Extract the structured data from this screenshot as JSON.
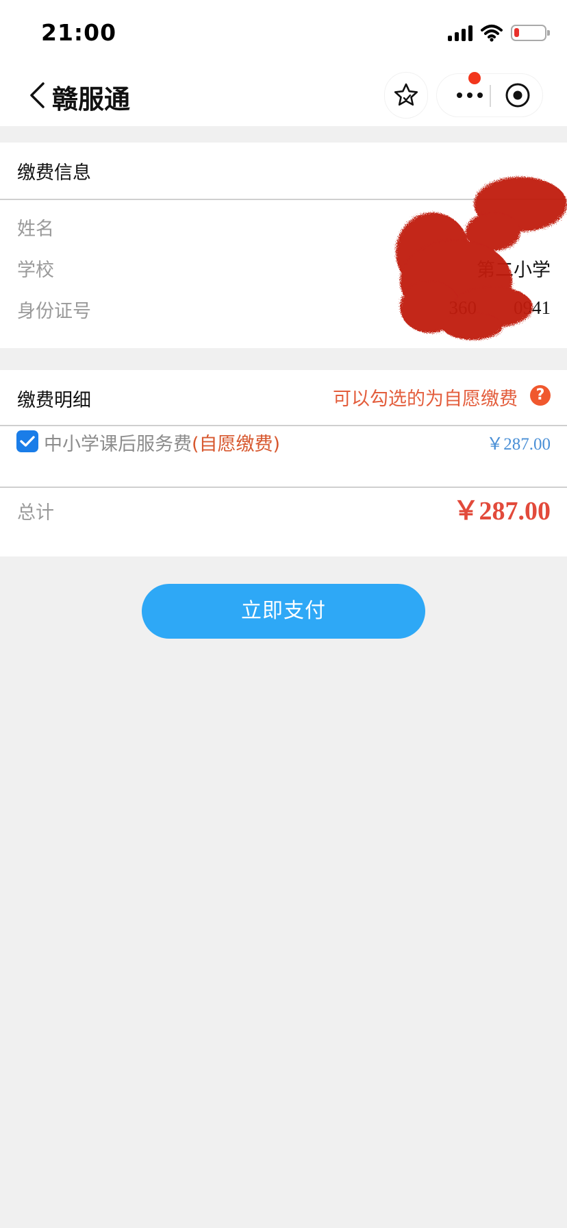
{
  "status_bar": {
    "time": "21:00",
    "icons": [
      "signal-icon",
      "wifi-icon",
      "battery-low-icon"
    ],
    "battery_level": 0.15,
    "battery_color": "#e8312c"
  },
  "nav": {
    "title": "赣服通",
    "back_icon": "chevron-left-icon",
    "favorite_icon": "star-icon",
    "more_icon": "more-dots-icon",
    "close_icon": "target-close-icon",
    "notification_dot_color": "#f2361c"
  },
  "payment_info": {
    "title": "缴费信息",
    "fields": [
      {
        "label": "姓名",
        "value": ""
      },
      {
        "label": "学校",
        "value": "第二小学"
      },
      {
        "label": "身份证号",
        "value": "360        0941"
      }
    ]
  },
  "payment_detail": {
    "title": "缴费明细",
    "hint": "可以勾选的为自愿缴费",
    "help_icon": "?",
    "items": [
      {
        "name": "中小学课后服务费",
        "tag": "(自愿缴费)",
        "price": "￥287.00",
        "checked": true
      }
    ],
    "total_label": "总计",
    "total_amount": "￥287.00"
  },
  "actions": {
    "pay_label": "立即支付"
  },
  "colors": {
    "accent": "#2ea8f6",
    "price_red": "#e24a3b",
    "hint_orange": "#e35d3c",
    "item_price_blue": "#4a8fd6",
    "checkbox_blue": "#1a7de8",
    "redaction_red": "#c01a0a"
  }
}
